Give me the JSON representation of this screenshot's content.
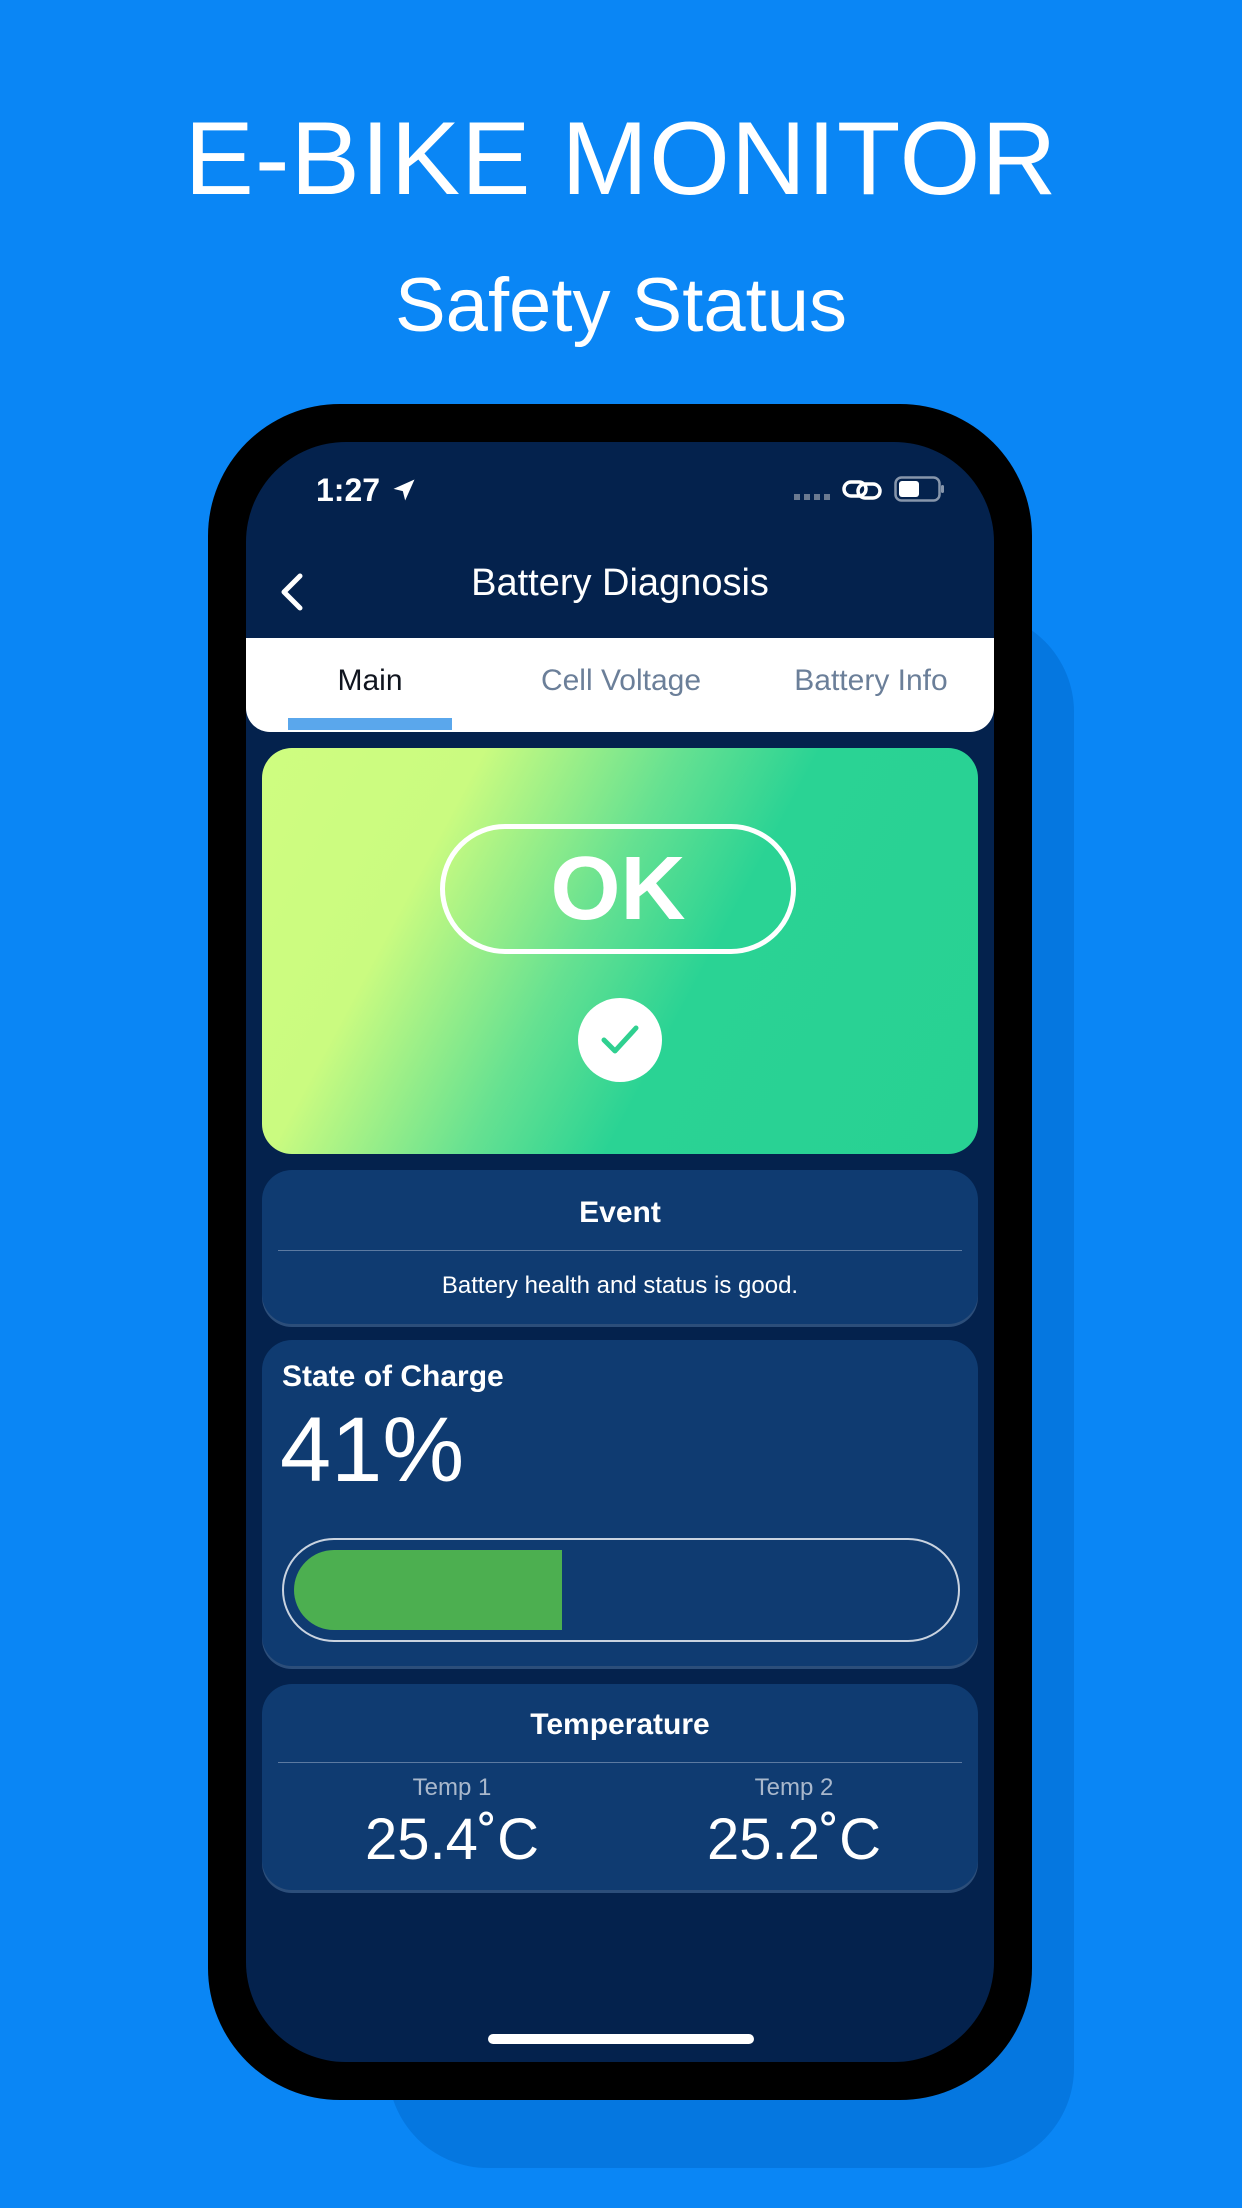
{
  "promo": {
    "headline": "E-BIKE MONITOR",
    "subheadline": "Safety Status"
  },
  "status_bar": {
    "time": "1:27",
    "icons": [
      "location-arrow-icon",
      "signal-icon",
      "link-icon",
      "battery-icon"
    ]
  },
  "nav": {
    "title": "Battery Diagnosis",
    "back_icon": "chevron-left-icon"
  },
  "tabs": {
    "items": [
      {
        "label": "Main",
        "active": true
      },
      {
        "label": "Cell Voltage",
        "active": false
      },
      {
        "label": "Battery Info",
        "active": false
      }
    ]
  },
  "status_card": {
    "label": "OK",
    "icon": "check-icon"
  },
  "event_card": {
    "title": "Event",
    "message": "Battery health and status is good."
  },
  "soc_card": {
    "title": "State of Charge",
    "value_text": "41%",
    "level_percent": 41,
    "fill_color": "#4caf50"
  },
  "temperature_card": {
    "title": "Temperature",
    "sensors": [
      {
        "label": "Temp 1",
        "value": "25.4˚C"
      },
      {
        "label": "Temp 2",
        "value": "25.2˚C"
      }
    ]
  },
  "colors": {
    "background": "#0a86f5",
    "screen": "#04224d",
    "card": "#0f3b71",
    "tab_indicator": "#5aa7ec"
  }
}
